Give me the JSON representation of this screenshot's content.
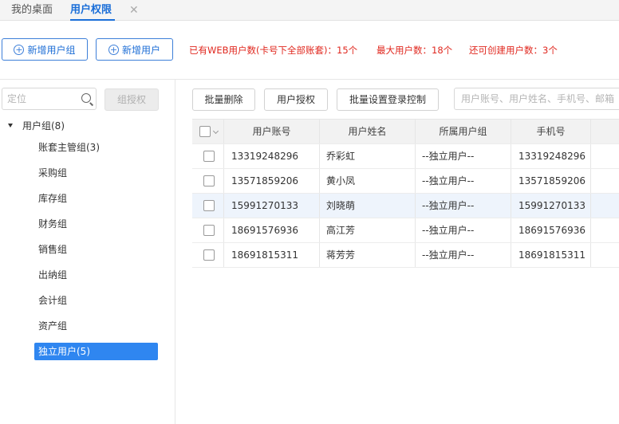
{
  "tabs": {
    "home": "我的桌面",
    "active": "用户权限",
    "close": "✕"
  },
  "toolbar": {
    "add_group": "新增用户组",
    "add_user": "新增用户",
    "web_users": "已有WEB用户数(卡号下全部账套)：15个",
    "max_users": "最大用户数：18个",
    "remaining": "还可创建用户数：3个",
    "accent": "#1f6fd6",
    "alert_color": "#e0271e"
  },
  "left": {
    "locate_placeholder": "定位",
    "group_grant": "组授权",
    "root": "用户组(8)",
    "items": [
      {
        "label": "账套主管组(3)"
      },
      {
        "label": "采购组"
      },
      {
        "label": "库存组"
      },
      {
        "label": "财务组"
      },
      {
        "label": "销售组"
      },
      {
        "label": "出纳组"
      },
      {
        "label": "会计组"
      },
      {
        "label": "资产组"
      },
      {
        "label": "独立用户(5)",
        "selected": true
      }
    ]
  },
  "actions": {
    "batch_delete": "批量删除",
    "user_auth": "用户授权",
    "batch_login": "批量设置登录控制",
    "search_placeholder": "用户账号、用户姓名、手机号、邮箱"
  },
  "table": {
    "columns": [
      "用户账号",
      "用户姓名",
      "所属用户组",
      "手机号"
    ],
    "rows": [
      [
        "13319248296",
        "乔彩虹",
        "--独立用户--",
        "13319248296"
      ],
      [
        "13571859206",
        "黄小凤",
        "--独立用户--",
        "13571859206"
      ],
      [
        "15991270133",
        "刘晓萌",
        "--独立用户--",
        "15991270133"
      ],
      [
        "18691576936",
        "高江芳",
        "--独立用户--",
        "18691576936"
      ],
      [
        "18691815311",
        "蒋芳芳",
        "--独立用户--",
        "18691815311"
      ]
    ],
    "highlight_row": 2
  }
}
